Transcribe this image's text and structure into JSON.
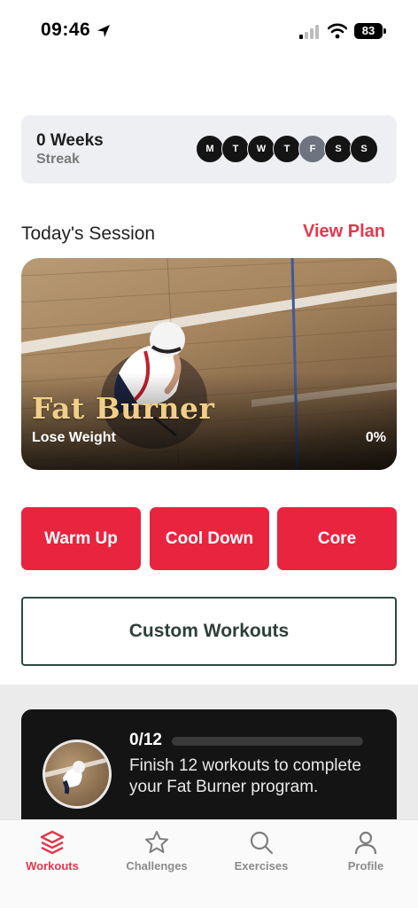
{
  "status_bar": {
    "time": "09:46",
    "battery": "83"
  },
  "streak": {
    "weeks": "0 Weeks",
    "label": "Streak",
    "days": [
      "M",
      "T",
      "W",
      "T",
      "F",
      "S",
      "S"
    ],
    "today_index": 4
  },
  "session": {
    "title": "Today's Session",
    "view_plan": "View Plan"
  },
  "hero": {
    "title": "Fat Burner",
    "subtitle": "Lose Weight",
    "progress": "0%"
  },
  "quick_buttons": [
    {
      "label": "Warm Up"
    },
    {
      "label": "Cool Down"
    },
    {
      "label": "Core"
    }
  ],
  "custom": {
    "label": "Custom Workouts"
  },
  "program": {
    "count": "0/12",
    "progress_fraction": 0,
    "text": "Finish 12 workouts to complete your Fat Burner program."
  },
  "tabs": [
    {
      "label": "Workouts",
      "icon": "layers-icon",
      "active": true
    },
    {
      "label": "Challenges",
      "icon": "star-icon",
      "active": false
    },
    {
      "label": "Exercises",
      "icon": "search-icon",
      "active": false
    },
    {
      "label": "Profile",
      "icon": "user-icon",
      "active": false
    }
  ],
  "colors": {
    "accent": "#e8243f",
    "link": "#e0394d",
    "dark": "#141414"
  }
}
